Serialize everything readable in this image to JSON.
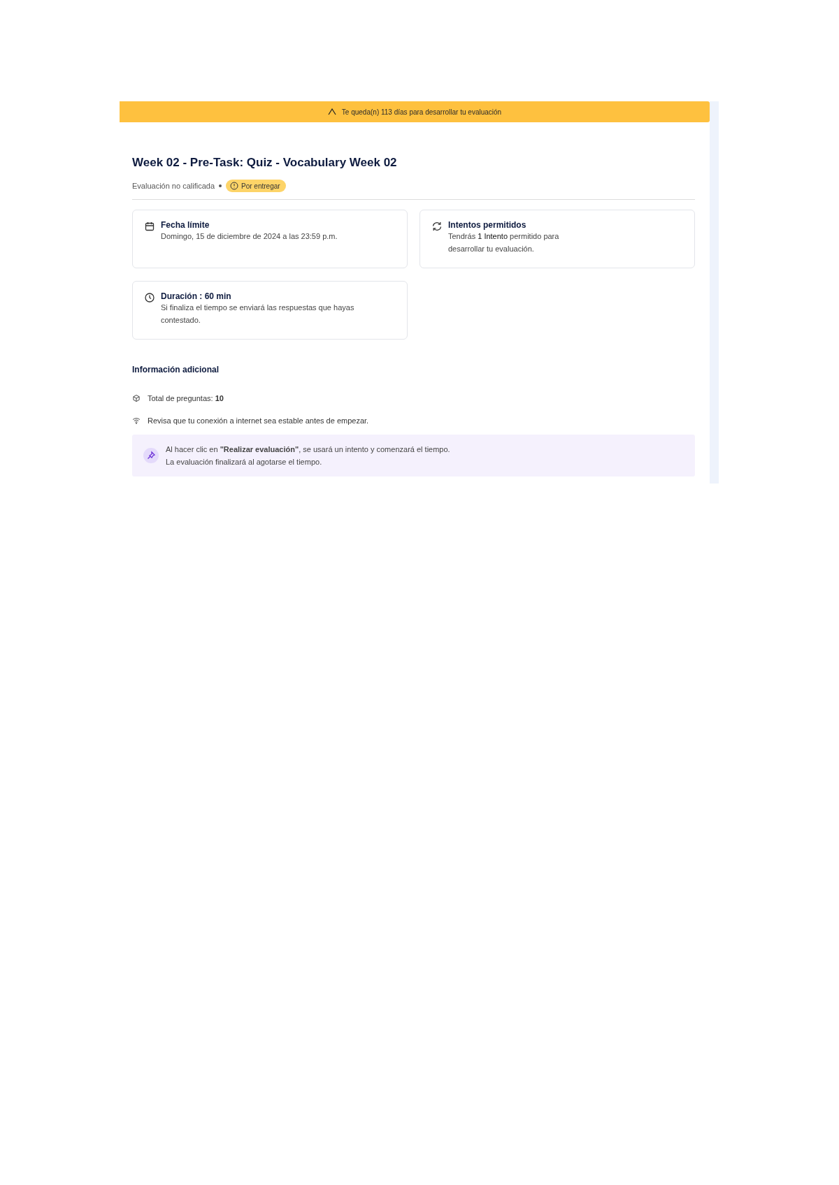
{
  "banner": {
    "text": "Te queda(n) 113 días para desarrollar tu evaluación"
  },
  "title": "Week 02 - Pre-Task: Quiz - Vocabulary Week 02",
  "status": {
    "label": "Evaluación no calificada",
    "badge": "Por entregar"
  },
  "cards": [
    {
      "kind": "calendar",
      "title": "Fecha límite",
      "lines": [
        "Domingo, 15 de diciembre de 2024 a las 23:59 p.m."
      ]
    },
    {
      "kind": "refresh",
      "title": "Intentos permitidos",
      "lines": [
        "Tendrás **1 Intento** permitido para",
        "desarrollar tu evaluación."
      ]
    },
    {
      "kind": "clock",
      "title": "Duración : 60 min",
      "lines": [
        "Si finaliza el tiempo se enviará las respuestas que hayas",
        "contestado."
      ]
    }
  ],
  "additional": {
    "heading": "Información adicional",
    "items": [
      {
        "kind": "questions",
        "text": "Total de preguntas: **10**"
      },
      {
        "kind": "wifi",
        "text": "Revisa que tu conexión a internet sea estable antes de empezar."
      }
    ]
  },
  "note": {
    "lines": [
      "Al hacer clic en **\"Realizar evaluación\"**, se usará un intento y comenzará el tiempo.",
      "La evaluación finalizará al agotarse el tiempo."
    ]
  }
}
